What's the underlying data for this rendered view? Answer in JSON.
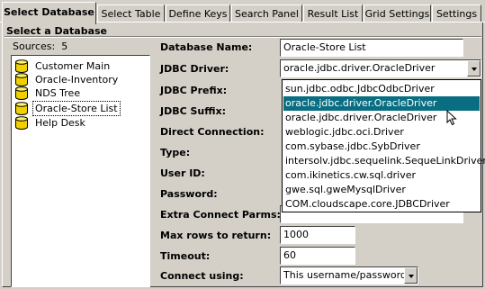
{
  "tabs": [
    {
      "label": "Select Database",
      "active": true
    },
    {
      "label": "Select Table"
    },
    {
      "label": "Define Keys"
    },
    {
      "label": "Search Panel"
    },
    {
      "label": "Result List"
    },
    {
      "label": "Grid Settings"
    },
    {
      "label": "Settings"
    }
  ],
  "group": {
    "title": "Select a Database"
  },
  "sources": {
    "label": "Sources:",
    "count": "5"
  },
  "databases": [
    {
      "label": "Customer Main"
    },
    {
      "label": "Oracle-Inventory"
    },
    {
      "label": "NDS Tree"
    },
    {
      "label": "Oracle-Store List",
      "selected": true
    },
    {
      "label": "Help Desk"
    }
  ],
  "form": {
    "database_name_label": "Database Name:",
    "database_name_value": "Oracle-Store List",
    "jdbc_driver_label": "JDBC Driver:",
    "jdbc_driver_value": "oracle.jdbc.driver.OracleDriver",
    "jdbc_prefix_label": "JDBC Prefix:",
    "jdbc_suffix_label": "JDBC Suffix:",
    "direct_connection_label": "Direct Connection:",
    "type_label": "Type:",
    "user_id_label": "User ID:",
    "password_label": "Password:",
    "extra_connect_label": "Extra Connect Parms:",
    "max_rows_label": "Max rows to return:",
    "max_rows_value": "1000",
    "timeout_label": "Timeout:",
    "timeout_value": "60",
    "connect_using_label": "Connect using:",
    "connect_using_value": "This username/password"
  },
  "driver_dropdown": {
    "options": [
      "sun.jdbc.odbc.JdbcOdbcDriver",
      "oracle.jdbc.driver.OracleDriver",
      "oracle.jdbc.driver.OracleDriver",
      "weblogic.jdbc.oci.Driver",
      "com.sybase.jdbc.SybDriver",
      "intersolv.jdbc.sequelink.SequeLinkDriver",
      "com.ikinetics.cw.sql.driver",
      "gwe.sql.gweMysqlDriver",
      "COM.cloudscape.core.JDBCDriver"
    ],
    "highlighted_index": 1
  },
  "colors": {
    "face": "#d4d0c8",
    "highlight": "#0a6e82",
    "db_icon": "#f0d000"
  }
}
